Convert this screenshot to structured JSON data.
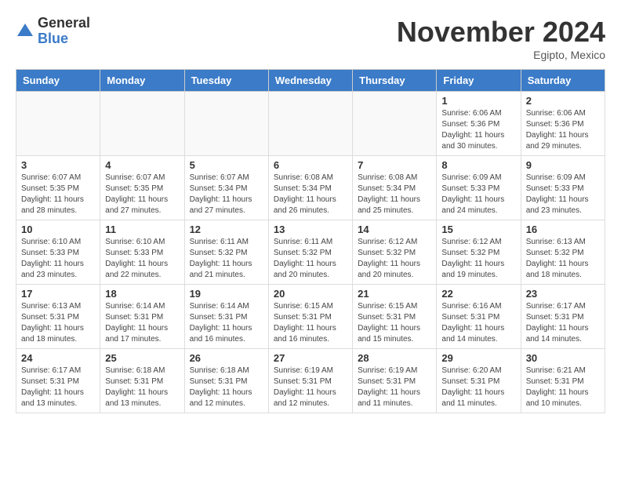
{
  "logo": {
    "general": "General",
    "blue": "Blue"
  },
  "title": "November 2024",
  "subtitle": "Egipto, Mexico",
  "weekdays": [
    "Sunday",
    "Monday",
    "Tuesday",
    "Wednesday",
    "Thursday",
    "Friday",
    "Saturday"
  ],
  "weeks": [
    [
      {
        "day": "",
        "info": ""
      },
      {
        "day": "",
        "info": ""
      },
      {
        "day": "",
        "info": ""
      },
      {
        "day": "",
        "info": ""
      },
      {
        "day": "",
        "info": ""
      },
      {
        "day": "1",
        "info": "Sunrise: 6:06 AM\nSunset: 5:36 PM\nDaylight: 11 hours\nand 30 minutes."
      },
      {
        "day": "2",
        "info": "Sunrise: 6:06 AM\nSunset: 5:36 PM\nDaylight: 11 hours\nand 29 minutes."
      }
    ],
    [
      {
        "day": "3",
        "info": "Sunrise: 6:07 AM\nSunset: 5:35 PM\nDaylight: 11 hours\nand 28 minutes."
      },
      {
        "day": "4",
        "info": "Sunrise: 6:07 AM\nSunset: 5:35 PM\nDaylight: 11 hours\nand 27 minutes."
      },
      {
        "day": "5",
        "info": "Sunrise: 6:07 AM\nSunset: 5:34 PM\nDaylight: 11 hours\nand 27 minutes."
      },
      {
        "day": "6",
        "info": "Sunrise: 6:08 AM\nSunset: 5:34 PM\nDaylight: 11 hours\nand 26 minutes."
      },
      {
        "day": "7",
        "info": "Sunrise: 6:08 AM\nSunset: 5:34 PM\nDaylight: 11 hours\nand 25 minutes."
      },
      {
        "day": "8",
        "info": "Sunrise: 6:09 AM\nSunset: 5:33 PM\nDaylight: 11 hours\nand 24 minutes."
      },
      {
        "day": "9",
        "info": "Sunrise: 6:09 AM\nSunset: 5:33 PM\nDaylight: 11 hours\nand 23 minutes."
      }
    ],
    [
      {
        "day": "10",
        "info": "Sunrise: 6:10 AM\nSunset: 5:33 PM\nDaylight: 11 hours\nand 23 minutes."
      },
      {
        "day": "11",
        "info": "Sunrise: 6:10 AM\nSunset: 5:33 PM\nDaylight: 11 hours\nand 22 minutes."
      },
      {
        "day": "12",
        "info": "Sunrise: 6:11 AM\nSunset: 5:32 PM\nDaylight: 11 hours\nand 21 minutes."
      },
      {
        "day": "13",
        "info": "Sunrise: 6:11 AM\nSunset: 5:32 PM\nDaylight: 11 hours\nand 20 minutes."
      },
      {
        "day": "14",
        "info": "Sunrise: 6:12 AM\nSunset: 5:32 PM\nDaylight: 11 hours\nand 20 minutes."
      },
      {
        "day": "15",
        "info": "Sunrise: 6:12 AM\nSunset: 5:32 PM\nDaylight: 11 hours\nand 19 minutes."
      },
      {
        "day": "16",
        "info": "Sunrise: 6:13 AM\nSunset: 5:32 PM\nDaylight: 11 hours\nand 18 minutes."
      }
    ],
    [
      {
        "day": "17",
        "info": "Sunrise: 6:13 AM\nSunset: 5:31 PM\nDaylight: 11 hours\nand 18 minutes."
      },
      {
        "day": "18",
        "info": "Sunrise: 6:14 AM\nSunset: 5:31 PM\nDaylight: 11 hours\nand 17 minutes."
      },
      {
        "day": "19",
        "info": "Sunrise: 6:14 AM\nSunset: 5:31 PM\nDaylight: 11 hours\nand 16 minutes."
      },
      {
        "day": "20",
        "info": "Sunrise: 6:15 AM\nSunset: 5:31 PM\nDaylight: 11 hours\nand 16 minutes."
      },
      {
        "day": "21",
        "info": "Sunrise: 6:15 AM\nSunset: 5:31 PM\nDaylight: 11 hours\nand 15 minutes."
      },
      {
        "day": "22",
        "info": "Sunrise: 6:16 AM\nSunset: 5:31 PM\nDaylight: 11 hours\nand 14 minutes."
      },
      {
        "day": "23",
        "info": "Sunrise: 6:17 AM\nSunset: 5:31 PM\nDaylight: 11 hours\nand 14 minutes."
      }
    ],
    [
      {
        "day": "24",
        "info": "Sunrise: 6:17 AM\nSunset: 5:31 PM\nDaylight: 11 hours\nand 13 minutes."
      },
      {
        "day": "25",
        "info": "Sunrise: 6:18 AM\nSunset: 5:31 PM\nDaylight: 11 hours\nand 13 minutes."
      },
      {
        "day": "26",
        "info": "Sunrise: 6:18 AM\nSunset: 5:31 PM\nDaylight: 11 hours\nand 12 minutes."
      },
      {
        "day": "27",
        "info": "Sunrise: 6:19 AM\nSunset: 5:31 PM\nDaylight: 11 hours\nand 12 minutes."
      },
      {
        "day": "28",
        "info": "Sunrise: 6:19 AM\nSunset: 5:31 PM\nDaylight: 11 hours\nand 11 minutes."
      },
      {
        "day": "29",
        "info": "Sunrise: 6:20 AM\nSunset: 5:31 PM\nDaylight: 11 hours\nand 11 minutes."
      },
      {
        "day": "30",
        "info": "Sunrise: 6:21 AM\nSunset: 5:31 PM\nDaylight: 11 hours\nand 10 minutes."
      }
    ]
  ]
}
